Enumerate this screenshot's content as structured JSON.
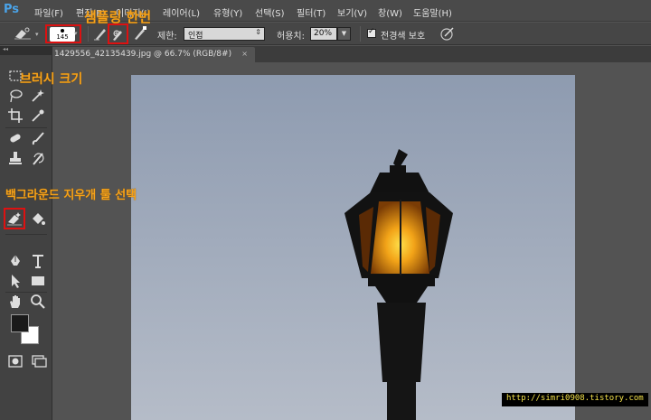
{
  "app": {
    "logo": "Ps",
    "menu": [
      "파일(F)",
      "편집(E)",
      "이미지(I)",
      "레이어(L)",
      "유형(Y)",
      "선택(S)",
      "필터(T)",
      "보기(V)",
      "창(W)",
      "도움말(H)"
    ]
  },
  "options": {
    "brush_size": "145",
    "limit_label": "제한:",
    "limit_value": "인접",
    "tolerance_label": "허용치:",
    "tolerance_value": "20%",
    "protect_label": "전경색 보호",
    "protect_checked": true
  },
  "document": {
    "tab_title": "1429556_42135439.jpg @ 66.7% (RGB/8#)",
    "close": "×"
  },
  "annotations": {
    "sampling": "샘플링 한번",
    "brush_size": "브러시 크기",
    "tool_select": "백그라운드 지우개 툴 선택"
  },
  "watermark": "http://simri0908.tistory.com",
  "colors": {
    "highlight": "#dd1111",
    "annotation": "#f6a21a",
    "foreground": "#1a1a1a",
    "background": "#ffffff"
  },
  "icons": {
    "eraser": "background-eraser-icon",
    "marquee": "marquee-icon",
    "lasso": "lasso-icon",
    "wand": "magic-wand-icon",
    "crop": "crop-icon",
    "eyedropper": "eyedropper-icon",
    "healing": "healing-brush-icon",
    "brush": "brush-icon",
    "stamp": "clone-stamp-icon",
    "history": "history-brush-icon",
    "bucket": "paint-bucket-icon",
    "pen": "pen-icon",
    "type": "type-icon",
    "path": "path-selection-icon",
    "rect": "rectangle-icon",
    "hand": "hand-icon",
    "zoom": "zoom-icon"
  }
}
